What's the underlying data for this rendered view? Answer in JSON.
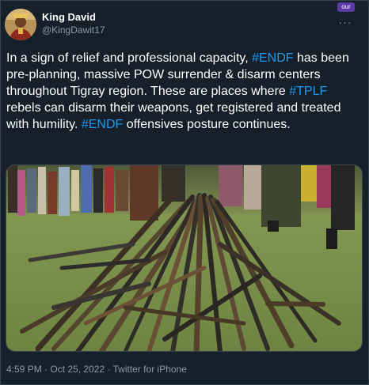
{
  "author": {
    "display_name": "King David",
    "handle": "@KingDawit17",
    "avatar_icon": "user-avatar-icon"
  },
  "badge": {
    "label": "our"
  },
  "menu": {
    "icon": "more-horizontal-icon",
    "glyph": "···"
  },
  "tweet": {
    "text_segments": [
      {
        "type": "text",
        "value": "In a sign of relief and professional capacity, "
      },
      {
        "type": "hashtag",
        "value": "#ENDF"
      },
      {
        "type": "text",
        "value": " has been pre-planning, massive POW surrender & disarm centers throughout Tigray region. These are places where "
      },
      {
        "type": "hashtag",
        "value": "#TPLF"
      },
      {
        "type": "text",
        "value": " rebels can disarm their weapons, get registered and treated with humility. "
      },
      {
        "type": "hashtag",
        "value": "#ENDF"
      },
      {
        "type": "text",
        "value": " offensives posture continues."
      }
    ]
  },
  "media": {
    "kind": "photo"
  },
  "meta": {
    "timestamp": "4:59 PM · Oct 25, 2022 · Twitter for iPhone"
  },
  "colors": {
    "background": "#15202b",
    "text": "#ffffff",
    "secondary_text": "#8b98a5",
    "hashtag": "#1d9bf0",
    "border": "#38444d",
    "badge": "#5b3aa6"
  }
}
